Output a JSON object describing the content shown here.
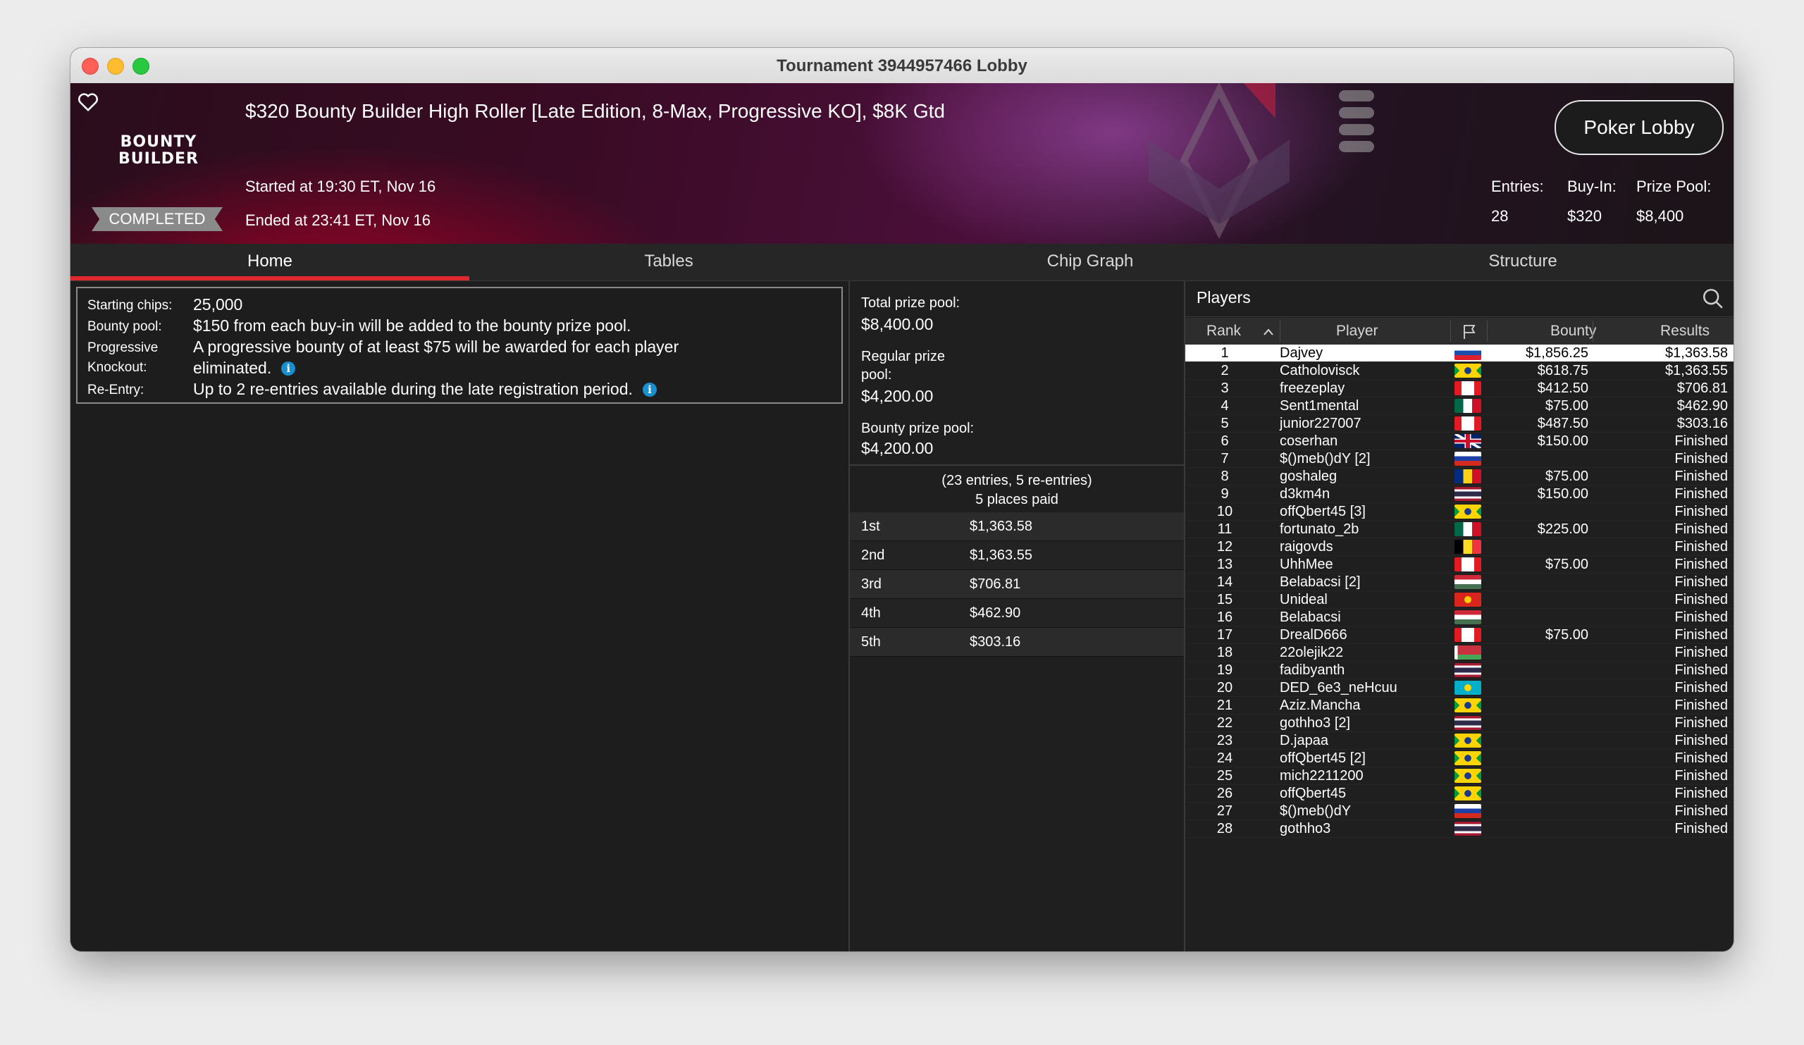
{
  "window": {
    "title": "Tournament 3944957466 Lobby"
  },
  "banner": {
    "logo_line1": "BOUNTY",
    "logo_line2": "BUILDER",
    "status": "COMPLETED",
    "title": "$320 Bounty Builder High Roller [Late Edition, 8-Max, Progressive KO], $8K Gtd",
    "started": "Started at 19:30 ET, Nov 16",
    "ended": "Ended at 23:41 ET, Nov 16",
    "lobby_button": "Poker Lobby",
    "entries_label": "Entries:",
    "buyin_label": "Buy-In:",
    "prizepool_label": "Prize Pool:",
    "entries": "28",
    "buyin": "$320",
    "prizepool": "$8,400"
  },
  "tabs": [
    {
      "label": "Home",
      "active": true
    },
    {
      "label": "Tables",
      "active": false
    },
    {
      "label": "Chip Graph",
      "active": false
    },
    {
      "label": "Structure",
      "active": false
    }
  ],
  "info": {
    "starting_chips_label": "Starting chips:",
    "starting_chips": "25,000",
    "bounty_pool_label": "Bounty pool:",
    "bounty_pool": "$150 from each buy-in will be added to the bounty prize pool.",
    "progressive_label_1": "Progressive",
    "progressive_label_2": "Knockout:",
    "progressive_1": "A progressive bounty of at least $75 will be awarded for each player",
    "progressive_2": "eliminated.",
    "reentry_label": "Re-Entry:",
    "reentry": "Up to 2 re-entries available during the late registration period.",
    "info_glyph": "i"
  },
  "prizes": {
    "total_label": "Total prize pool:",
    "total": "$8,400.00",
    "regular_label_1": "Regular prize",
    "regular_label_2": "pool:",
    "regular": "$4,200.00",
    "bounty_label": "Bounty prize pool:",
    "bounty": "$4,200.00",
    "entries_line": "(23 entries, 5 re-entries)",
    "paid_line": "5 places paid",
    "places": [
      {
        "place": "1st",
        "amount": "$1,363.58"
      },
      {
        "place": "2nd",
        "amount": "$1,363.55"
      },
      {
        "place": "3rd",
        "amount": "$706.81"
      },
      {
        "place": "4th",
        "amount": "$462.90"
      },
      {
        "place": "5th",
        "amount": "$303.16"
      }
    ]
  },
  "players": {
    "title": "Players",
    "columns": {
      "rank": "Rank",
      "player": "Player",
      "bounty": "Bounty",
      "results": "Results"
    },
    "sort_icon": "chevron-up-icon",
    "rows": [
      {
        "rank": "1",
        "name": "Dajvey",
        "flag": "sk",
        "bounty": "$1,856.25",
        "result": "$1,363.58",
        "selected": true
      },
      {
        "rank": "2",
        "name": "Catholovisck",
        "flag": "br",
        "bounty": "$618.75",
        "result": "$1,363.55"
      },
      {
        "rank": "3",
        "name": "freezeplay",
        "flag": "ca",
        "bounty": "$412.50",
        "result": "$706.81"
      },
      {
        "rank": "4",
        "name": "Sent1mental",
        "flag": "mx",
        "bounty": "$75.00",
        "result": "$462.90"
      },
      {
        "rank": "5",
        "name": "junior227007",
        "flag": "ca",
        "bounty": "$487.50",
        "result": "$303.16"
      },
      {
        "rank": "6",
        "name": "coserhan",
        "flag": "gb",
        "bounty": "$150.00",
        "result": "Finished"
      },
      {
        "rank": "7",
        "name": "$()meb()dY [2]",
        "flag": "ru",
        "bounty": "",
        "result": "Finished"
      },
      {
        "rank": "8",
        "name": "goshaleg",
        "flag": "ro",
        "bounty": "$75.00",
        "result": "Finished"
      },
      {
        "rank": "9",
        "name": "d3km4n",
        "flag": "th",
        "bounty": "$150.00",
        "result": "Finished"
      },
      {
        "rank": "10",
        "name": "offQbert45 [3]",
        "flag": "br",
        "bounty": "",
        "result": "Finished"
      },
      {
        "rank": "11",
        "name": "fortunato_2b",
        "flag": "mx",
        "bounty": "$225.00",
        "result": "Finished"
      },
      {
        "rank": "12",
        "name": "raigovds",
        "flag": "be",
        "bounty": "",
        "result": "Finished"
      },
      {
        "rank": "13",
        "name": "UhhMee",
        "flag": "ca",
        "bounty": "$75.00",
        "result": "Finished"
      },
      {
        "rank": "14",
        "name": "Belabacsi [2]",
        "flag": "hu",
        "bounty": "",
        "result": "Finished"
      },
      {
        "rank": "15",
        "name": "Unideal",
        "flag": "vn",
        "bounty": "",
        "result": "Finished"
      },
      {
        "rank": "16",
        "name": "Belabacsi",
        "flag": "hu",
        "bounty": "",
        "result": "Finished"
      },
      {
        "rank": "17",
        "name": "DrealD666",
        "flag": "ca",
        "bounty": "$75.00",
        "result": "Finished"
      },
      {
        "rank": "18",
        "name": "22olejik22",
        "flag": "by",
        "bounty": "",
        "result": "Finished"
      },
      {
        "rank": "19",
        "name": "fadibyanth",
        "flag": "th",
        "bounty": "",
        "result": "Finished"
      },
      {
        "rank": "20",
        "name": "DED_6e3_neHcuu",
        "flag": "kz",
        "bounty": "",
        "result": "Finished"
      },
      {
        "rank": "21",
        "name": "Aziz.Mancha",
        "flag": "br",
        "bounty": "",
        "result": "Finished"
      },
      {
        "rank": "22",
        "name": "gothho3 [2]",
        "flag": "th",
        "bounty": "",
        "result": "Finished"
      },
      {
        "rank": "23",
        "name": "D.japaa",
        "flag": "br",
        "bounty": "",
        "result": "Finished"
      },
      {
        "rank": "24",
        "name": "offQbert45 [2]",
        "flag": "br",
        "bounty": "",
        "result": "Finished"
      },
      {
        "rank": "25",
        "name": "mich2211200",
        "flag": "br",
        "bounty": "",
        "result": "Finished"
      },
      {
        "rank": "26",
        "name": "offQbert45",
        "flag": "br",
        "bounty": "",
        "result": "Finished"
      },
      {
        "rank": "27",
        "name": "$()meb()dY",
        "flag": "ru",
        "bounty": "",
        "result": "Finished"
      },
      {
        "rank": "28",
        "name": "gothho3",
        "flag": "th",
        "bounty": "",
        "result": "Finished"
      }
    ]
  }
}
